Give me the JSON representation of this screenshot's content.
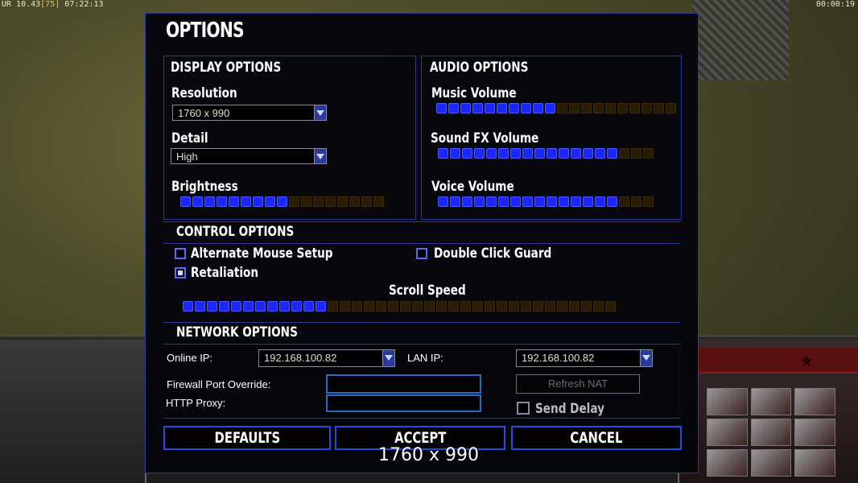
{
  "hud": {
    "left_prefix": "UR 10.43",
    "left_bracket": "[75]",
    "left_time": "07:22:13",
    "right_time": "00:00:19"
  },
  "dialog": {
    "title": "OPTIONS"
  },
  "display": {
    "heading": "DISPLAY OPTIONS",
    "resolution_label": "Resolution",
    "resolution_value": "1760 x 990",
    "detail_label": "Detail",
    "detail_value": "High",
    "brightness_label": "Brightness",
    "brightness_level": "9/17"
  },
  "audio": {
    "heading": "AUDIO OPTIONS",
    "music_label": "Music Volume",
    "music_level": "10/20",
    "sfx_label": "Sound FX Volume",
    "sfx_level": "15/18",
    "voice_label": "Voice Volume",
    "voice_level": "15/18"
  },
  "control": {
    "heading": "CONTROL OPTIONS",
    "alt_mouse_label": "Alternate Mouse Setup",
    "alt_mouse_checked": false,
    "double_click_label": "Double Click Guard",
    "double_click_checked": false,
    "retaliation_label": "Retaliation",
    "retaliation_checked": true,
    "scroll_label": "Scroll Speed",
    "scroll_level": "12/36"
  },
  "network": {
    "heading": "NETWORK OPTIONS",
    "online_ip_label": "Online IP:",
    "online_ip_value": "192.168.100.82",
    "lan_ip_label": "LAN IP:",
    "lan_ip_value": "192.168.100.82",
    "firewall_label": "Firewall Port Override:",
    "firewall_value": "",
    "proxy_label": "HTTP Proxy:",
    "proxy_value": "",
    "refresh_nat_label": "Refresh NAT",
    "send_delay_label": "Send Delay",
    "send_delay_checked": false
  },
  "buttons": {
    "defaults": "DEFAULTS",
    "accept": "ACCEPT",
    "cancel": "CANCEL"
  },
  "overlay": {
    "resolution_text": "1760 x 990"
  },
  "colors": {
    "accent_blue": "#1a28ff",
    "border_blue": "#2a3a9a",
    "slider_off": "#2a1c00"
  },
  "icons": {
    "dropdown_arrow": "chevron-down-icon",
    "checkbox": "checkbox-icon"
  }
}
